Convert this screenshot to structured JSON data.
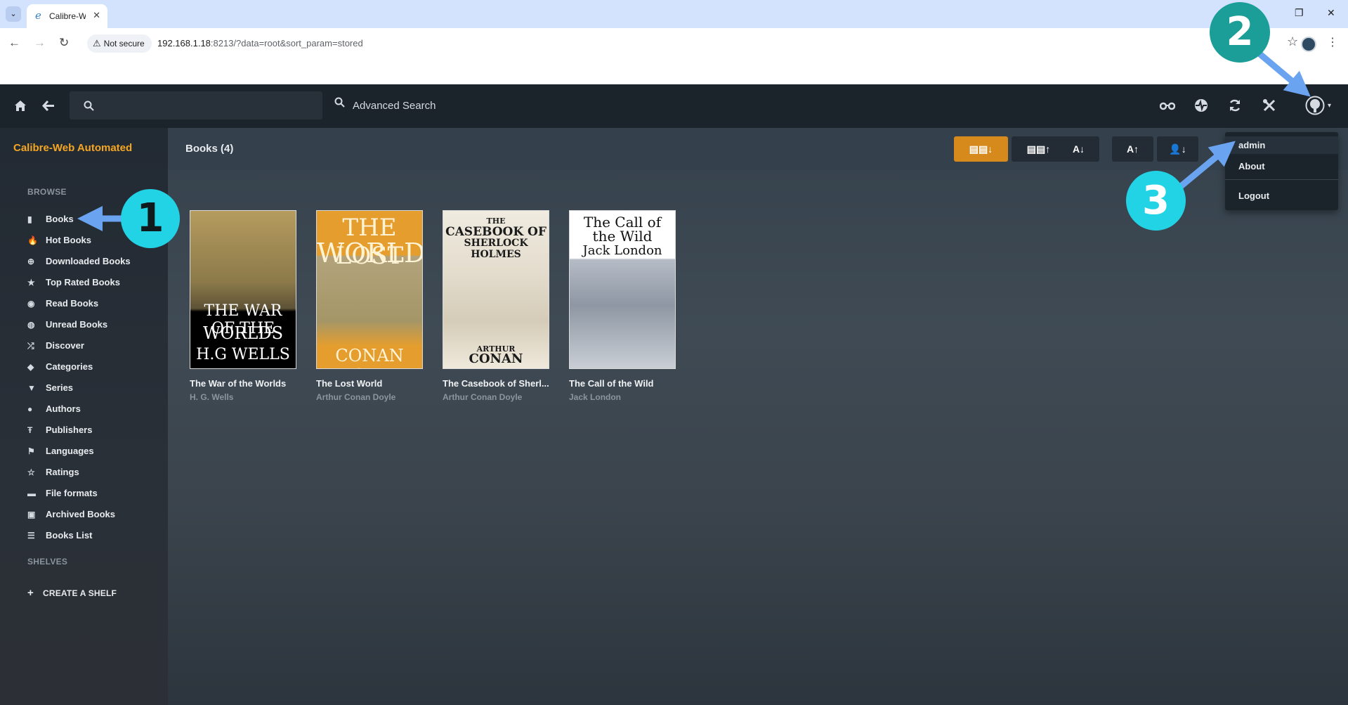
{
  "browser": {
    "tab_title": "Calibre-W",
    "security_label": "Not secure",
    "url_host": "192.168.1.18",
    "url_rest": ":8213/?data=root&sort_param=stored"
  },
  "app": {
    "brand": "Calibre-Web Automated",
    "search_placeholder": "",
    "advanced_search": "Advanced Search",
    "page_title": "Books (4)"
  },
  "sidebar": {
    "browse_label": "BROWSE",
    "shelves_label": "SHELVES",
    "create_shelf": "CREATE A SHELF",
    "items": [
      {
        "label": "Books",
        "icon": "book-icon"
      },
      {
        "label": "Hot Books",
        "icon": "fire-icon"
      },
      {
        "label": "Downloaded Books",
        "icon": "download-icon"
      },
      {
        "label": "Top Rated Books",
        "icon": "star-icon"
      },
      {
        "label": "Read Books",
        "icon": "eye-icon"
      },
      {
        "label": "Unread Books",
        "icon": "eye-slash-icon"
      },
      {
        "label": "Discover",
        "icon": "shuffle-icon"
      },
      {
        "label": "Categories",
        "icon": "tags-icon"
      },
      {
        "label": "Series",
        "icon": "bookmark-icon"
      },
      {
        "label": "Authors",
        "icon": "user-icon"
      },
      {
        "label": "Publishers",
        "icon": "text-icon"
      },
      {
        "label": "Languages",
        "icon": "flag-icon"
      },
      {
        "label": "Ratings",
        "icon": "star-outline-icon"
      },
      {
        "label": "File formats",
        "icon": "file-icon"
      },
      {
        "label": "Archived Books",
        "icon": "archive-icon"
      },
      {
        "label": "Books List",
        "icon": "list-icon"
      }
    ]
  },
  "books": [
    {
      "title": "The War of the Worlds",
      "author": "H. G. Wells",
      "cover_text": [
        "THE WAR OF THE",
        "WORLDS",
        "H.G WELLS"
      ]
    },
    {
      "title": "The Lost World",
      "author": "Arthur Conan Doyle",
      "cover_text": [
        "THE LOST",
        "WORLD",
        "CONAN DOYLE"
      ]
    },
    {
      "title": "The Casebook of Sherl...",
      "author": "Arthur Conan Doyle",
      "cover_text": [
        "THE",
        "CASEBOOK OF",
        "SHERLOCK HOLMES",
        "ARTHUR",
        "CONAN DOYLE"
      ]
    },
    {
      "title": "The Call of the Wild",
      "author": "Jack London",
      "cover_text": [
        "The Call of",
        "the Wild",
        "Jack London"
      ]
    }
  ],
  "sort_buttons": [
    {
      "label": "▤▤↓",
      "active": true
    },
    {
      "label": "▤▤↑",
      "active": false
    },
    {
      "label": "A↓",
      "active": false
    },
    {
      "label": "A↑",
      "active": false
    },
    {
      "label": "👤↓",
      "active": false
    }
  ],
  "user_menu": {
    "username": "admin",
    "about": "About",
    "logout": "Logout"
  },
  "annotations": [
    "1",
    "2",
    "3"
  ],
  "colors": {
    "accent": "#d68a1c",
    "brand": "#f5a623",
    "annotation_cyan": "#22d3e6",
    "annotation_teal": "#1a9e97",
    "arrow_blue": "#6aa4f0"
  }
}
